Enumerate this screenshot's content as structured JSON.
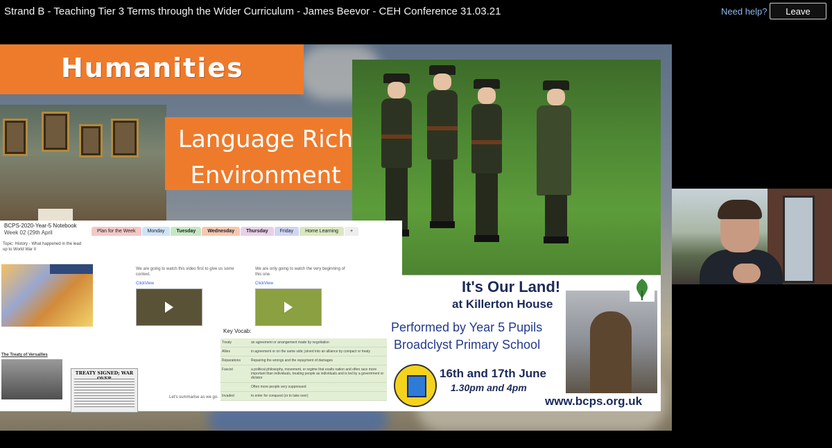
{
  "meeting": {
    "title": "Strand B - Teaching Tier 3 Terms through the Wider Curriculum - James Beevor - CEH Conference 31.03.21",
    "help_label": "Need help?",
    "leave_label": "Leave"
  },
  "slide": {
    "humanities_title": "Humanities",
    "language_line1": "Language Rich",
    "language_line2": "Environment"
  },
  "notebook": {
    "title": "BCPS-2020-Year-5 Notebook",
    "week": "Week 02 (29th April",
    "tabs": [
      {
        "label": "Plan for the Week",
        "color": "#f4c7c7"
      },
      {
        "label": "Monday",
        "color": "#cfe3f7"
      },
      {
        "label": "Tuesday",
        "color": "#c6e7c4"
      },
      {
        "label": "Wednesday",
        "color": "#f7c7b0"
      },
      {
        "label": "Thursday",
        "color": "#e8d0e8"
      },
      {
        "label": "Friday",
        "color": "#cfd5f3"
      },
      {
        "label": "Home Learning",
        "color": "#d8e8c0"
      },
      {
        "label": "+",
        "color": "#eeeeee"
      }
    ],
    "heading": "Topic: History - What happened in the lead up to World War II",
    "video1_text": "We are going to watch this video first to give us some context.",
    "video1_link": "ClickView",
    "video2_text": "We are only going to watch the very beginning of this one.",
    "video2_link": "ClickView",
    "treaty_heading": "The Treaty of Versailles",
    "newspaper_headline": "TREATY SIGNED; WAR OVER",
    "summarise_text": "Let's summarise as we go.",
    "vocab_label": "Key Vocab:",
    "vocab": [
      {
        "term": "Treaty",
        "def": "an agreement or arrangement made by negotiation"
      },
      {
        "term": "Allies",
        "def": "in agreement or on the same side; joined into an alliance by compact or treaty"
      },
      {
        "term": "Reparations",
        "def": "Repairing the wrongs and the repayment of damages"
      },
      {
        "term": "Fascist",
        "def": "a political philosophy, movement, or regime that exalts nation and often race more important than individuals, treating people as individuals and is led by a government or dictator"
      },
      {
        "term": "",
        "def": "Often more people very suppressed"
      },
      {
        "term": "Invaded",
        "def": "to enter for conquest (or to take over)"
      }
    ]
  },
  "poster": {
    "title": "It's Our Land!",
    "subtitle": "at Killerton House",
    "line1": "Performed by Year 5 Pupils",
    "line2": "Broadclyst Primary School",
    "dates": "16th and 17th June",
    "times": "1.30pm and 4pm",
    "url": "www.bcps.org.uk"
  }
}
